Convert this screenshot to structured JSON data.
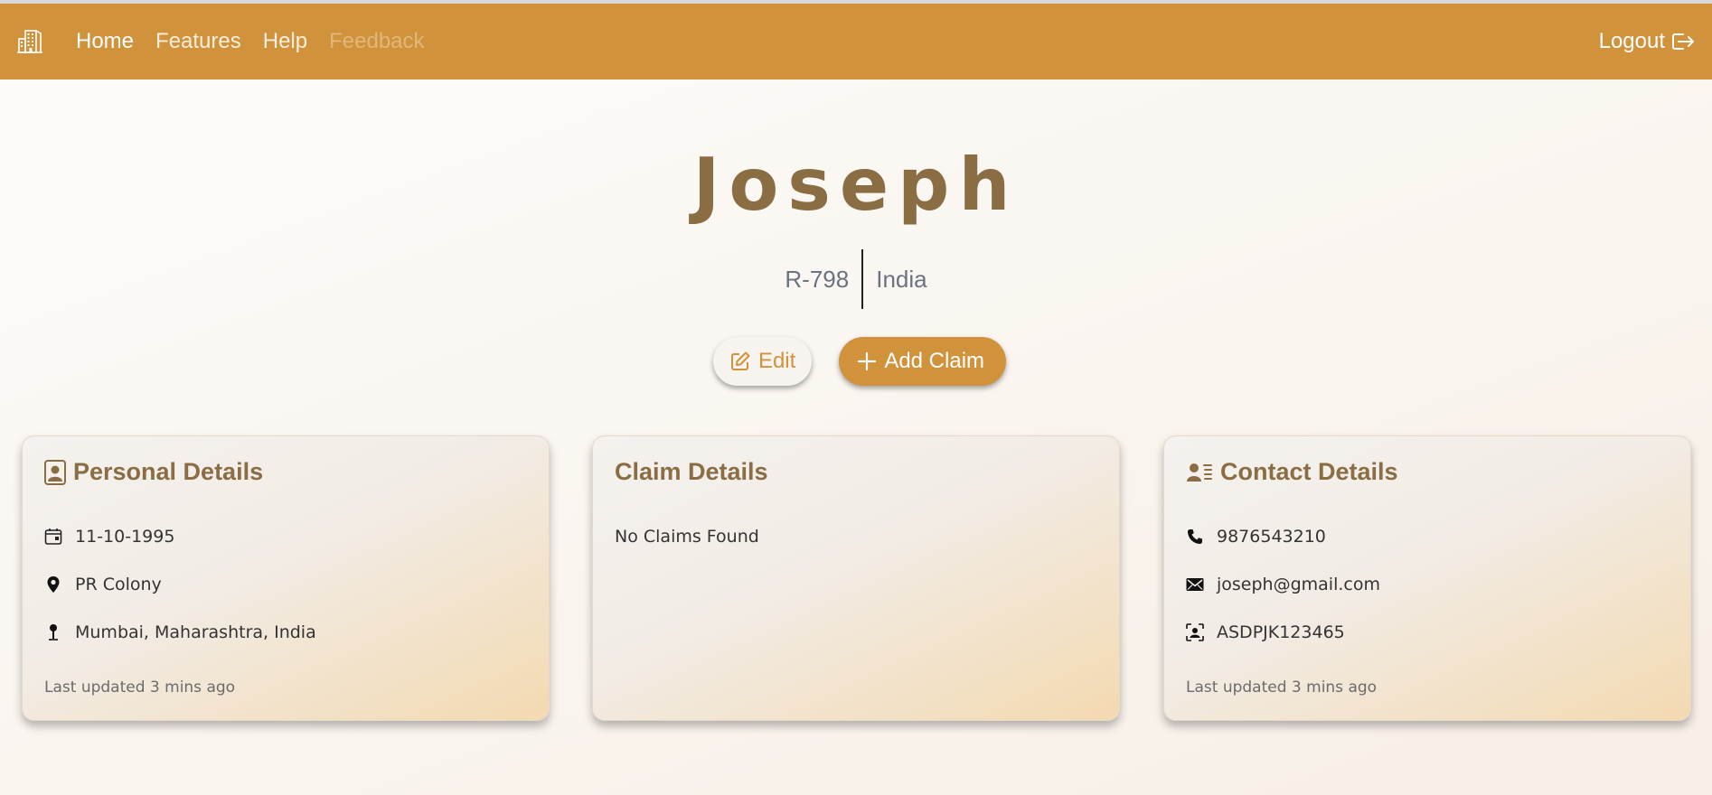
{
  "nav": {
    "links": [
      "Home",
      "Features",
      "Help",
      "Feedback"
    ],
    "logout": "Logout"
  },
  "profile": {
    "name": "Joseph",
    "id": "R-798",
    "country": "India"
  },
  "actions": {
    "edit": "Edit",
    "add_claim": "Add Claim"
  },
  "personal": {
    "title": "Personal Details",
    "dob": "11-10-1995",
    "address": "PR Colony",
    "location": "Mumbai, Maharashtra, India",
    "updated": "Last updated 3 mins ago"
  },
  "claims": {
    "title": "Claim Details",
    "empty": "No Claims Found"
  },
  "contact": {
    "title": "Contact Details",
    "phone": "9876543210",
    "email": "joseph@gmail.com",
    "id_number": "ASDPJK123465",
    "updated": "Last updated 3 mins ago"
  },
  "colors": {
    "brand": "#d0923b",
    "heading": "#8b6d43"
  }
}
